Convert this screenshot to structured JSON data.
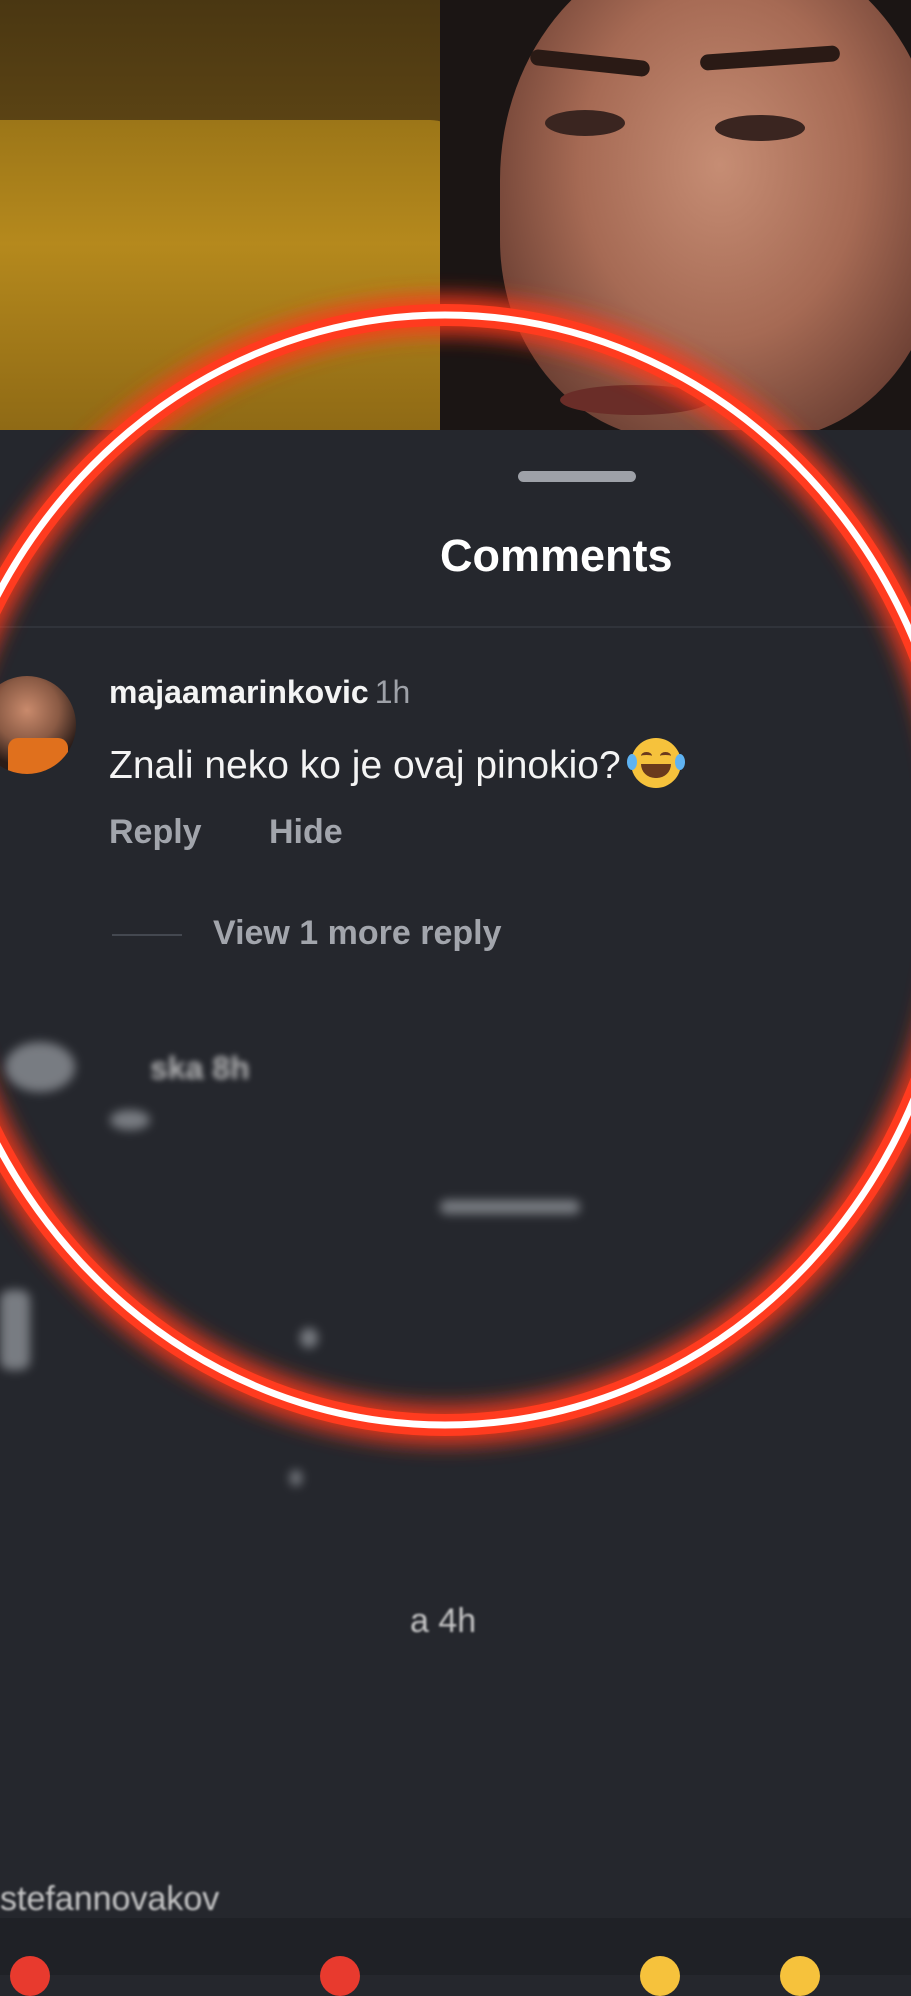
{
  "sheet": {
    "title": "Comments"
  },
  "comments": [
    {
      "username": "majaamarinkovic",
      "time": "1h",
      "text": "Znali neko ko je ovaj pinokio?",
      "reply_label": "Reply",
      "hide_label": "Hide",
      "more_replies_label": "View 1 more reply"
    }
  ],
  "obscured": {
    "frag1": "ska 8h",
    "frag2": "a 4h",
    "frag3": "stefannovakov"
  },
  "colors": {
    "sheet_bg": "#25272d",
    "highlight_ring": "#ff3b1f"
  },
  "icons": {
    "emoji": "face-with-tears-of-joy-icon"
  }
}
